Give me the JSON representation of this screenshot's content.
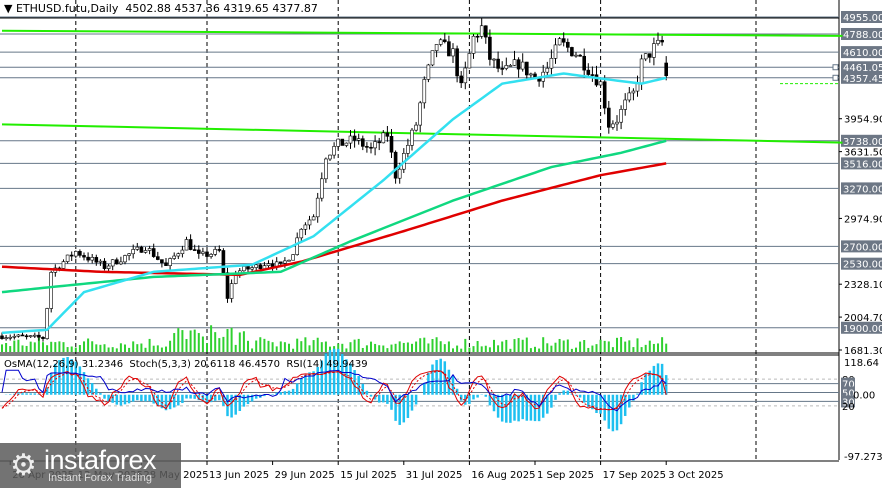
{
  "header": {
    "symbol": "ETHUSD.futu,Daily",
    "open": "4502.88",
    "high": "4537.36",
    "low": "4319.65",
    "close": "4377.87"
  },
  "indicator_header": {
    "osma": "OsMA(12,26,9) 31.2346",
    "stoch": "Stoch(5,3,3) 20.6118 46.4570",
    "rsi": "RSI(14) 49.9439"
  },
  "logo": {
    "brand": "instaforex",
    "tagline": "Instant Forex Trading"
  },
  "colors": {
    "ma_fast": "#33e0f0",
    "ma_mid": "#10d880",
    "ma_slow": "#e00000",
    "trend": "#22ee00",
    "level": "#667788",
    "label_bg": "#6d7785",
    "hist": "#1ec0f0"
  },
  "chart_data": {
    "type": "candlestick",
    "title": "ETHUSD.futu,Daily",
    "price_axis": {
      "min": 1681.3,
      "max": 4955.0,
      "ticks": [
        "3954.90",
        "3631.50",
        "2974.90",
        "2328.10",
        "2004.70",
        "1681.30"
      ]
    },
    "levels": [
      {
        "value": 4955.0,
        "label": "4955.00"
      },
      {
        "value": 4788.0,
        "label": "4788.00"
      },
      {
        "value": 4610.0,
        "label": "4610.00"
      },
      {
        "value": 4461.05,
        "label": "4461.05"
      },
      {
        "value": 4357.45,
        "label": "4357.45"
      },
      {
        "value": 3738.0,
        "label": "3738.00"
      },
      {
        "value": 3516.0,
        "label": "3516.00"
      },
      {
        "value": 3270.0,
        "label": "3270.00"
      },
      {
        "value": 2700.0,
        "label": "2700.00"
      },
      {
        "value": 2530.0,
        "label": "2530.00"
      },
      {
        "value": 1900.0,
        "label": "1900.00"
      }
    ],
    "x_labels": [
      {
        "day": 2,
        "label": "26 Apr 2025"
      },
      {
        "day": 18,
        "label": "12 May 2025"
      },
      {
        "day": 34,
        "label": "28 May 2025"
      },
      {
        "day": 50,
        "label": "13 Jun 2025"
      },
      {
        "day": 66,
        "label": "29 Jun 2025"
      },
      {
        "day": 82,
        "label": "15 Jul 2025"
      },
      {
        "day": 98,
        "label": "31 Jul 2025"
      },
      {
        "day": 114,
        "label": "16 Aug 2025"
      },
      {
        "day": 130,
        "label": "1 Sep 2025"
      },
      {
        "day": 146,
        "label": "17 Sep 2025"
      },
      {
        "day": 162,
        "label": "3 Oct 2025"
      }
    ],
    "close_keypoints": [
      [
        0,
        1820
      ],
      [
        10,
        1800
      ],
      [
        11,
        2100
      ],
      [
        12,
        2450
      ],
      [
        15,
        2550
      ],
      [
        18,
        2650
      ],
      [
        25,
        2500
      ],
      [
        30,
        2600
      ],
      [
        35,
        2700
      ],
      [
        40,
        2500
      ],
      [
        45,
        2750
      ],
      [
        48,
        2600
      ],
      [
        53,
        2650
      ],
      [
        55,
        2200
      ],
      [
        57,
        2450
      ],
      [
        62,
        2500
      ],
      [
        65,
        2550
      ],
      [
        68,
        2500
      ],
      [
        71,
        2650
      ],
      [
        73,
        2900
      ],
      [
        76,
        3000
      ],
      [
        79,
        3600
      ],
      [
        82,
        3700
      ],
      [
        86,
        3750
      ],
      [
        90,
        3650
      ],
      [
        94,
        3800
      ],
      [
        96,
        3400
      ],
      [
        99,
        3700
      ],
      [
        101,
        3900
      ],
      [
        103,
        4300
      ],
      [
        106,
        4700
      ],
      [
        110,
        4600
      ],
      [
        112,
        4250
      ],
      [
        115,
        4750
      ],
      [
        117,
        4850
      ],
      [
        119,
        4550
      ],
      [
        122,
        4400
      ],
      [
        126,
        4500
      ],
      [
        130,
        4350
      ],
      [
        133,
        4450
      ],
      [
        136,
        4700
      ],
      [
        140,
        4600
      ],
      [
        144,
        4400
      ],
      [
        146,
        4300
      ],
      [
        148,
        3900
      ],
      [
        150,
        3950
      ],
      [
        152,
        4100
      ],
      [
        154,
        4200
      ],
      [
        156,
        4500
      ],
      [
        159,
        4650
      ],
      [
        161,
        4700
      ],
      [
        162,
        4377.87
      ]
    ],
    "ma_fast": [
      [
        0,
        1850
      ],
      [
        11,
        1880
      ],
      [
        20,
        2250
      ],
      [
        37,
        2450
      ],
      [
        61,
        2520
      ],
      [
        76,
        2800
      ],
      [
        93,
        3350
      ],
      [
        110,
        3950
      ],
      [
        122,
        4300
      ],
      [
        137,
        4400
      ],
      [
        146,
        4350
      ],
      [
        156,
        4300
      ],
      [
        162,
        4357.45
      ]
    ],
    "ma_mid": [
      [
        0,
        2250
      ],
      [
        12,
        2300
      ],
      [
        37,
        2400
      ],
      [
        68,
        2450
      ],
      [
        85,
        2750
      ],
      [
        110,
        3150
      ],
      [
        134,
        3480
      ],
      [
        151,
        3620
      ],
      [
        162,
        3738
      ]
    ],
    "ma_slow": [
      [
        0,
        2500
      ],
      [
        24,
        2450
      ],
      [
        58,
        2420
      ],
      [
        73,
        2550
      ],
      [
        98,
        2850
      ],
      [
        122,
        3150
      ],
      [
        146,
        3400
      ],
      [
        162,
        3516
      ]
    ],
    "trendlines": [
      {
        "from": [
          0,
          4820
        ],
        "to": [
          205,
          4770
        ]
      },
      {
        "from": [
          0,
          3900
        ],
        "to": [
          205,
          3720
        ]
      }
    ],
    "indicator_axis": {
      "max": "118.64",
      "min": "-97.2731",
      "levels": [
        "80",
        "70",
        "50",
        "30",
        "20"
      ],
      "zero": "0.00"
    }
  }
}
